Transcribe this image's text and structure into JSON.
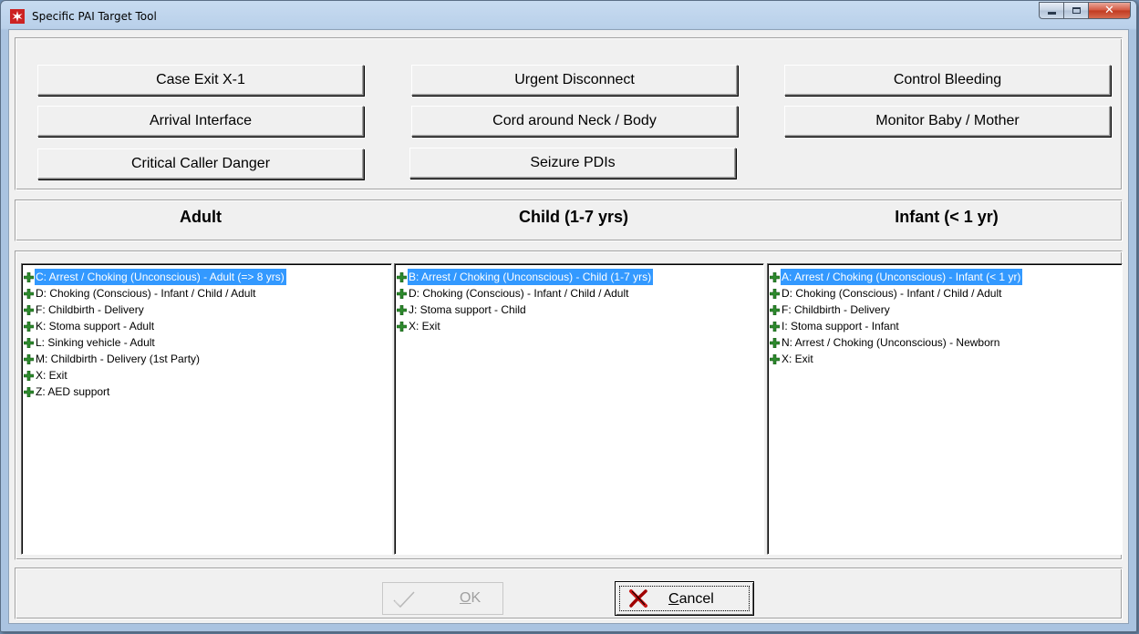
{
  "window": {
    "title": "Specific PAI Target Tool",
    "icon": "star-of-life-icon",
    "controls": {
      "minimize": "minimize-icon",
      "maximize": "maximize-icon",
      "close": "close-icon"
    }
  },
  "actions": [
    {
      "label": "Case Exit  X-1"
    },
    {
      "label": "Urgent Disconnect"
    },
    {
      "label": "Control Bleeding"
    },
    {
      "label": "Arrival Interface"
    },
    {
      "label": "Cord around Neck / Body"
    },
    {
      "label": "Monitor Baby / Mother"
    },
    {
      "label": "Critical Caller Danger"
    },
    {
      "label": "Seizure PDIs"
    }
  ],
  "columns": [
    {
      "header": "Adult",
      "items": [
        {
          "label": "C: Arrest / Choking (Unconscious) - Adult (=> 8 yrs)",
          "selected": true
        },
        {
          "label": "D: Choking (Conscious) - Infant / Child / Adult"
        },
        {
          "label": "F: Childbirth - Delivery"
        },
        {
          "label": "K: Stoma support - Adult"
        },
        {
          "label": "L: Sinking vehicle - Adult"
        },
        {
          "label": "M: Childbirth - Delivery (1st Party)"
        },
        {
          "label": "X: Exit"
        },
        {
          "label": "Z: AED support"
        }
      ]
    },
    {
      "header": "Child (1-7 yrs)",
      "items": [
        {
          "label": "B: Arrest / Choking (Unconscious) - Child (1-7 yrs)",
          "selected": true
        },
        {
          "label": "D: Choking (Conscious) - Infant / Child / Adult"
        },
        {
          "label": "J: Stoma support - Child"
        },
        {
          "label": "X: Exit"
        }
      ]
    },
    {
      "header": "Infant (< 1 yr)",
      "items": [
        {
          "label": "A: Arrest / Choking (Unconscious) - Infant (< 1 yr)",
          "selected": true
        },
        {
          "label": "D: Choking (Conscious) - Infant / Child / Adult"
        },
        {
          "label": "F: Childbirth - Delivery"
        },
        {
          "label": "I: Stoma support - Infant"
        },
        {
          "label": "N: Arrest / Choking (Unconscious) - Newborn"
        },
        {
          "label": "X: Exit"
        }
      ]
    }
  ],
  "footer": {
    "ok": {
      "label_first": "O",
      "label_rest": "K",
      "icon": "checkmark-icon",
      "enabled": false
    },
    "cancel": {
      "label_first": "C",
      "label_rest": "ancel",
      "icon": "red-x-icon"
    }
  },
  "colors": {
    "selection": "#3399ff",
    "plus_icon": "#2e8b2e",
    "app_icon": "#cc2222"
  }
}
